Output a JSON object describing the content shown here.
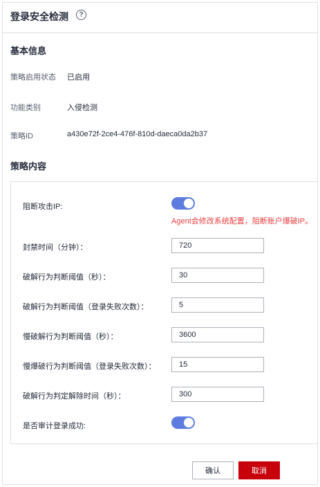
{
  "header": {
    "title": "登录安全检测",
    "help_icon": "?"
  },
  "basic_info": {
    "section_title": "基本信息",
    "rows": [
      {
        "label": "策略启用状态",
        "value": "已启用"
      },
      {
        "label": "功能类别",
        "value": "入侵检测"
      },
      {
        "label": "策略ID",
        "value": "a430e72f-2ce4-476f-810d-daeca0da2b37"
      }
    ]
  },
  "policy": {
    "section_title": "策略内容",
    "block_ip": {
      "label": "阻断攻击IP:",
      "enabled": true,
      "warning": "Agent会修改系统配置，阻断账户爆破IP。"
    },
    "fields": [
      {
        "label": "封禁时间（分钟）：",
        "value": "720"
      },
      {
        "label": "破解行为判断阈值（秒）：",
        "value": "30"
      },
      {
        "label": "破解行为判断阈值（登录失败次数）：",
        "value": "5"
      },
      {
        "label": "慢破解行为判断阈值（秒）：",
        "value": "3600"
      },
      {
        "label": "慢爆破行为判断阈值（登录失败次数）：",
        "value": "15"
      },
      {
        "label": "破解行为判定解除时间（秒）：",
        "value": "300"
      }
    ],
    "audit_success": {
      "label": "是否审计登录成功:",
      "enabled": true
    }
  },
  "footer": {
    "confirm_label": "确认",
    "cancel_label": "取消"
  },
  "colors": {
    "toggle_on": "#5e7ce0",
    "cancel_bg": "#c7000b",
    "warning": "#e84040"
  }
}
